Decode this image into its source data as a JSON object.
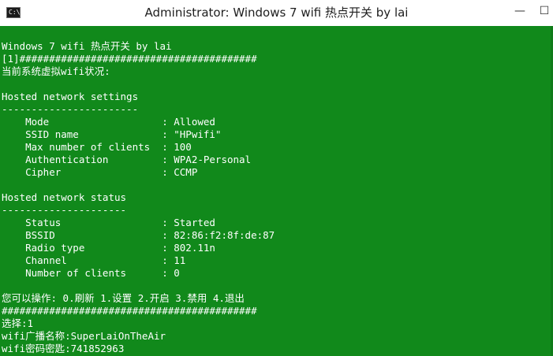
{
  "window": {
    "title": "Administrator:  Windows 7 wifi 热点开关 by lai",
    "icon_text": "C:\\.",
    "minimize_glyph": "—",
    "maximize_glyph": "☐",
    "console_bg": "#11891b",
    "console_fg": "#ffffff"
  },
  "console": {
    "lines": [
      "Windows 7 wifi 热点开关 by lai",
      "[1]########################################",
      "当前系统虚拟wifi状况:",
      "",
      "Hosted network settings",
      "-----------------------",
      "    Mode                   : Allowed",
      "    SSID name              : \"HPwifi\"",
      "    Max number of clients  : 100",
      "    Authentication         : WPA2-Personal",
      "    Cipher                 : CCMP",
      "",
      "Hosted network status",
      "---------------------",
      "    Status                 : Started",
      "    BSSID                  : 82:86:f2:8f:de:87",
      "    Radio type             : 802.11n",
      "    Channel                : 11",
      "    Number of clients      : 0",
      "",
      "您可以操作: 0.刷新 1.设置 2.开启 3.禁用 4.退出",
      "###########################################",
      "选择:1",
      "wifi广播名称:SuperLaiOnTheAir",
      "wifi密码密匙:741852963"
    ]
  }
}
